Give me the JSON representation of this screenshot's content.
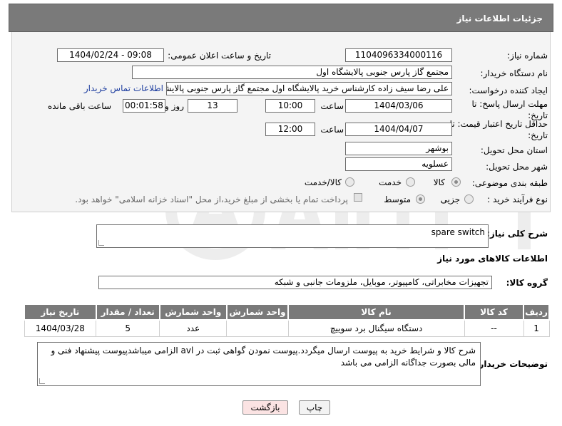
{
  "header": {
    "title": "جزئیات اطلاعات نیاز"
  },
  "form": {
    "need_number_label": "شماره نیاز:",
    "need_number": "1104096334000116",
    "announce_label": "تاریخ و ساعت اعلان عمومی:",
    "announce_value": "1404/02/24 - 09:08",
    "buyer_org_label": "نام دستگاه خریدار:",
    "buyer_org": "مجتمع گاز پارس جنوبی  پالایشگاه اول",
    "requester_label": "ایجاد کننده درخواست:",
    "requester": "علی رضا سیف زاده کارشناس خرید پالایشگاه اول مجتمع گاز پارس جنوبی  پالایشگاه",
    "contact_link": "اطلاعات تماس خریدار",
    "reply_deadline_label": "مهلت ارسال پاسخ: تا تاریخ:",
    "reply_date": "1404/03/06",
    "time_label": "ساعت",
    "reply_time": "10:00",
    "days_value": "13",
    "days_label": "روز و",
    "remaining_value": "00:01:58",
    "remaining_label": "ساعت باقی مانده",
    "price_validity_label": "حداقل تاریخ اعتبار قیمت: تا تاریخ:",
    "price_date": "1404/04/07",
    "price_time": "12:00",
    "province_label": "استان محل تحویل:",
    "province": "بوشهر",
    "city_label": "شهر محل تحویل:",
    "city": "عسلویه",
    "category_label": "طبقه بندی موضوعی:",
    "category_options": [
      "کالا",
      "خدمت",
      "کالا/خدمت"
    ],
    "process_label": "نوع فرآیند خرید :",
    "process_options": [
      "جزیی",
      "متوسط"
    ],
    "payment_note": "پرداخت تمام یا بخشی از مبلغ خرید،از محل \"اسناد خزانه اسلامی\" خواهد بود."
  },
  "description": {
    "label": "شرح کلی نیاز:",
    "value": "spare switch"
  },
  "goods": {
    "section_title": "اطلاعات کالاهای مورد نیاز",
    "group_label": "گروه کالا:",
    "group_value": "تجهیزات مخابراتی، کامپیوتر، موبایل، ملزومات جانبی و شبکه",
    "columns": [
      "ردیف",
      "کد کالا",
      "نام کالا",
      "واحد شمارش",
      "تعداد / مقدار",
      "تاریخ نیاز"
    ],
    "rows": [
      [
        "1",
        "--",
        "دستگاه سیگنال برد سوییچ",
        "عدد",
        "5",
        "1404/03/28"
      ]
    ]
  },
  "buyer_notes": {
    "label": "توضیحات خریدار:",
    "value": "شرح کالا و شرایط خرید به پیوست ارسال میگردد.پیوست نمودن گواهی ثبت در avl الزامی میباشدپیوست پیشنهاد فنی و مالی بصورت جداگانه الزامی می باشد"
  },
  "buttons": {
    "print": "چاپ",
    "back": "بازگشت"
  },
  "colors": {
    "header_bg": "#7a7a7a",
    "panel_bg": "#f4f4f4",
    "link": "#1f3fa0",
    "back_button_bg": "#fbe3e3"
  }
}
